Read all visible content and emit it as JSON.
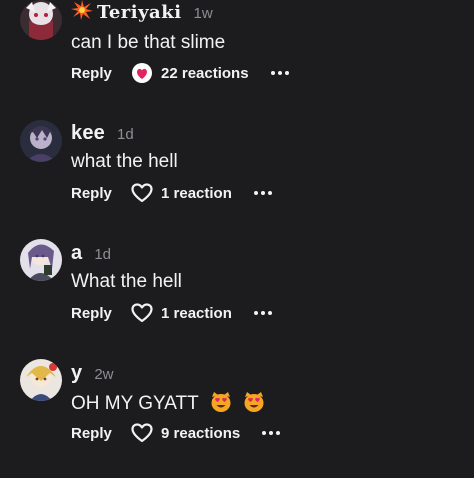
{
  "colors": {
    "background": "#1c1c1e",
    "text": "#f2f2f2",
    "muted": "#8e8e93",
    "reaction_red": "#e0245e"
  },
  "comments": [
    {
      "username": "Teriyaki",
      "username_icon": "sparkle-icon",
      "time": "1w",
      "text": "can I be that slime",
      "reply_label": "Reply",
      "reactions_label": "22 reactions",
      "reaction_icon": "heart-face-icon",
      "more_icon": "more-icon"
    },
    {
      "username": "kee",
      "time": "1d",
      "text": "what the hell",
      "reply_label": "Reply",
      "reactions_label": "1 reaction",
      "reaction_icon": "heart-outline-icon",
      "more_icon": "more-icon"
    },
    {
      "username": "a",
      "time": "1d",
      "text": "What the hell",
      "reply_label": "Reply",
      "reactions_label": "1 reaction",
      "reaction_icon": "heart-outline-icon",
      "more_icon": "more-icon"
    },
    {
      "username": "y",
      "time": "2w",
      "text": "OH MY GYATT",
      "text_emojis": [
        "heart-eyes-cat-emoji",
        "heart-eyes-cat-emoji"
      ],
      "reply_label": "Reply",
      "reactions_label": "9 reactions",
      "reaction_icon": "heart-outline-icon",
      "more_icon": "more-icon"
    }
  ]
}
